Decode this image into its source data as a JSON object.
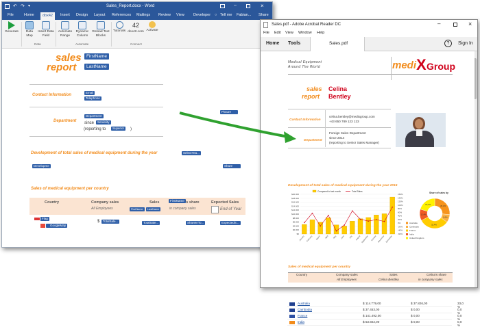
{
  "word": {
    "title": "Sales_Report.docx - Word",
    "quick_access": [
      "save",
      "undo",
      "redo",
      "customize"
    ],
    "window_controls": [
      "restore",
      "minimize",
      "maximize",
      "close"
    ],
    "tabs": [
      "File",
      "Home",
      "dox42",
      "Insert",
      "Design",
      "Layout",
      "References",
      "Mailings",
      "Review",
      "View",
      "Developer"
    ],
    "tell_me": "Tell me",
    "user": "Fabian...",
    "share": "Share",
    "ribbon": {
      "generate": "Generate",
      "data_map": "Data Map",
      "insert_data_field": "Insert Data Field",
      "automate_range": "Automate Range",
      "dynamic_column": "Dynamic Column",
      "reload_text_blocks": "Reload Text Blocks",
      "tutorials": "Tutorials",
      "dox42_com": "dox42.com",
      "activate": "Activate",
      "group_data": "Data",
      "group_automate": "Automate",
      "group_connect": "Connect"
    },
    "doc": {
      "sales": "sales",
      "report": "report",
      "firstname": "FirstName",
      "lastname": "LastName",
      "contact_info": "Contact Information",
      "email": "Email",
      "telephone": "Telephone",
      "department_label": "Department",
      "department": "Department",
      "since": "since",
      "seniority": "Seniority",
      "reporting_to": "(reporting to",
      "superior": "Superior",
      "close_paren": ")",
      "picture": "Picture",
      "dev_heading": "Development of total sales of medical equipment during the year",
      "select_year": "SelectYea...",
      "developme": "Developme",
      "share_field": "Share",
      "by_country": "Sales of medical equipment per country",
      "col_country": "Country",
      "col_company_sales": "Company sales",
      "col_all_employees": "All Employees",
      "col_sales": "Sales",
      "col_firstname": "FirstName",
      "col_lastname": "LastName",
      "col_share_suffix": "'s share",
      "col_in_company": "in company sales",
      "col_expected": "Expected Sales",
      "col_end_of_year": "End of Year",
      "flag": "Flag",
      "googlemap": "GoogleMap",
      "dollar": "$",
      "totalsales1": "TotalSale...",
      "totalsales2": "TotalSale...",
      "sharein": "ShareInTo...",
      "expected": "ExpectedS..."
    }
  },
  "acrobat": {
    "title": "Sales.pdf - Adobe Acrobat Reader DC",
    "window_controls": [
      "minimize",
      "maximize",
      "close"
    ],
    "menu": [
      "File",
      "Edit",
      "View",
      "Window",
      "Help"
    ],
    "nav": {
      "home": "Home",
      "tools": "Tools",
      "doc_tab": "Sales.pdf",
      "sign_in": "Sign In"
    },
    "pdf": {
      "tagline1": "Medical Equipment",
      "tagline2": "Around The World",
      "logo_a": "medi",
      "logo_x": "X",
      "logo_b": "Group",
      "sales": "sales",
      "report": "report",
      "first": "Celina",
      "last": "Bentley",
      "contact_info": "Contact Information",
      "email": "celina.bentley@medixgroup.com",
      "phone": "+43 650 789 123 123",
      "department_label": "Department",
      "dept_line1": "Foreign Sales Department",
      "dept_line2": "since 2014",
      "dept_line3": "(reporting to Senior Sales Manager)",
      "dev_heading": "Development of total sales of medical equipment during the year 2016",
      "by_country": "Sales of medical equipment per country",
      "table": {
        "headers": [
          "Country",
          "Company sales",
          "Sales",
          "Celina's share"
        ],
        "subheaders": [
          "",
          "All Employees",
          "Celina Bentley",
          "in company sales"
        ],
        "rows": [
          {
            "country": "Australia",
            "company": "$ 114.779,00",
            "sales": "$ 37.826,00",
            "share": "33,0 %"
          },
          {
            "country": "Cambodia",
            "company": "$ 37.453,00",
            "sales": "$ 0,00",
            "share": "0,0 %"
          },
          {
            "country": "France",
            "company": "$ 141.492,00",
            "sales": "$ 0,00",
            "share": "0,0 %"
          },
          {
            "country": "India",
            "company": "$ 53.922,00",
            "sales": "$ 0,00",
            "share": "0,0 %"
          }
        ]
      }
    }
  },
  "chart_data": [
    {
      "type": "bar",
      "title": "",
      "legend": [
        "Compared to last month",
        "Total Sales"
      ],
      "categories": [
        "January",
        "February",
        "March",
        "April",
        "May",
        "June",
        "July",
        "August",
        "September",
        "October",
        "November",
        "December"
      ],
      "series": [
        {
          "name": "Total Sales",
          "values": [
            4800,
            7200,
            5900,
            8200,
            4600,
            4000,
            6500,
            7700,
            8300,
            9600,
            10200,
            18600
          ]
        },
        {
          "name": "Compared to last month",
          "values": [
            0,
            50,
            -18,
            39,
            -44,
            -13,
            62,
            18,
            8,
            16,
            6,
            82
          ]
        }
      ],
      "y_ticks": [
        "$0",
        "$2.000",
        "$4.000",
        "$6.000",
        "$8.000",
        "$10.000",
        "$12.000",
        "$14.000",
        "$16.000",
        "$18.000",
        "$20.000"
      ],
      "y2_ticks": [
        "-60%",
        "-40%",
        "-20%",
        "0%",
        "20%",
        "40%",
        "60%",
        "80%",
        "100%",
        "120%",
        "140%",
        "150%"
      ],
      "ylim": [
        0,
        20000
      ]
    },
    {
      "type": "pie",
      "title": "Share of sales by",
      "labels": [
        "Australia",
        "Cambodia",
        "France",
        "India",
        "United Kingdom"
      ],
      "values": [
        26.2,
        8.6,
        32.4,
        12.4,
        20.4
      ],
      "data_labels": [
        "26,2%",
        "8,6%",
        "32,4%",
        "12,4%",
        "20,4%"
      ],
      "colors": [
        "#f7941d",
        "#fbb040",
        "#ffcc00",
        "#f15a24",
        "#fff200"
      ]
    }
  ],
  "colors": {
    "word_blue": "#2b579a",
    "orange": "#f28c1c",
    "red_name": "#d0021b",
    "arrow_green": "#2fa12f",
    "cc_blue": "#2f5fa8"
  }
}
